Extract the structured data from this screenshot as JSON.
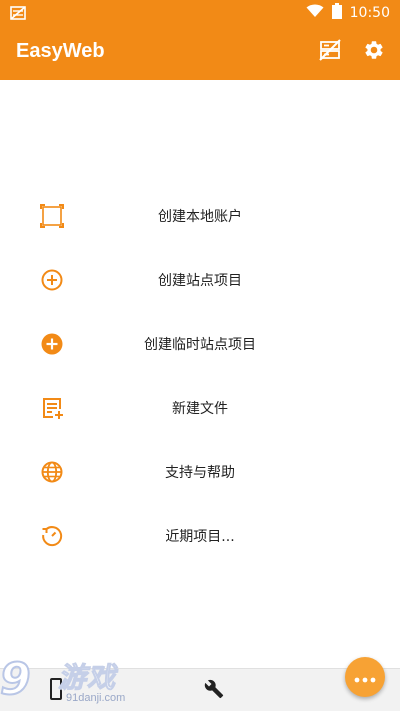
{
  "status_bar": {
    "time": "10:50",
    "icons": [
      "notification-icon",
      "wifi-icon",
      "battery-icon"
    ]
  },
  "app_bar": {
    "title": "EasyWeb",
    "actions": [
      "server-off-icon",
      "settings-icon"
    ]
  },
  "menu": {
    "items": [
      {
        "label": "创建本地账户",
        "icon": "crop-square-icon"
      },
      {
        "label": "创建站点项目",
        "icon": "add-circle-outline-icon"
      },
      {
        "label": "创建临时站点项目",
        "icon": "add-circle-filled-icon"
      },
      {
        "label": "新建文件",
        "icon": "new-file-icon"
      },
      {
        "label": "支持与帮助",
        "icon": "globe-icon"
      },
      {
        "label": "近期项目...",
        "icon": "history-icon"
      }
    ]
  },
  "bottom_bar": {
    "tabs": [
      "device-icon",
      "wrench-icon"
    ]
  },
  "watermark": {
    "logo": "9",
    "name": "游戏",
    "site": "91danji.com"
  },
  "fab": {
    "icon": "more-horizontal-icon"
  },
  "colors": {
    "accent": "#f28a16",
    "fab": "#f7a234"
  }
}
